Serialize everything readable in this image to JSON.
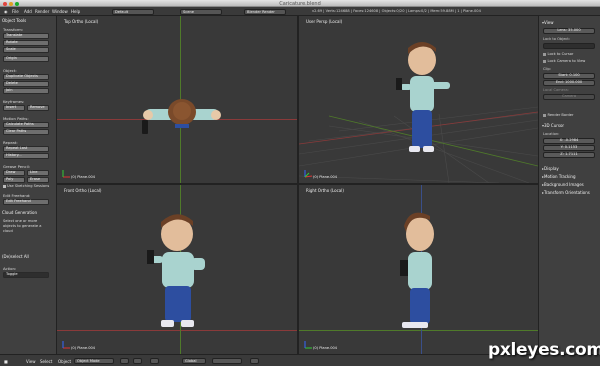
{
  "window": {
    "title": "Caricature.blend"
  },
  "menu": {
    "file": "File",
    "add": "Add",
    "render": "Render",
    "window": "Window",
    "help": "Help"
  },
  "header": {
    "layout": "Default",
    "scene": "Scene",
    "engine": "Blender Render",
    "stats": "v2.69 | Verts:124688 | Faces:124608 | Objects:0/20 | Lamps:0/2 | Mem:59.88M | 1 | Plane.004"
  },
  "toolshelf": {
    "title": "Object Tools",
    "transform_title": "Transform:",
    "translate": "Translate",
    "rotate": "Rotate",
    "scale": "Scale",
    "origin": "Origin",
    "object_title": "Object:",
    "duplicate_objects": "Duplicate Objects",
    "delete": "Delete",
    "join": "Join",
    "keyframes_title": "Keyframes:",
    "insert": "Insert",
    "remove": "Remove",
    "motion_paths_title": "Motion Paths:",
    "calculate_paths": "Calculate Paths",
    "clear_paths": "Clear Paths",
    "repeat_title": "Repeat:",
    "repeat_last": "Repeat Last",
    "history": "History...",
    "grease_pencil_title": "Grease Pencil:",
    "draw": "Draw",
    "line": "Line",
    "poly": "Poly",
    "erase": "Erase",
    "use_sketching": "Use Sketching Sessions",
    "edit_title": "Edit Freehand:",
    "edit_freehand": "Edit Freehand",
    "cloud_title": "Cloud Generation",
    "cloud_hint": "Select one or more objects to generate a cloud",
    "last_op_title": "(De)select All",
    "action_label": "Action:",
    "action_value": "Toggle"
  },
  "viewports": {
    "top_left": {
      "label": "Top Ortho (Local)",
      "object": "(0) Plane.004"
    },
    "top_right": {
      "label": "User Persp (Local)",
      "object": "(0) Plane.004"
    },
    "bottom_left": {
      "label": "Front Ortho (Local)",
      "object": "(0) Plane.004"
    },
    "bottom_right": {
      "label": "Right Ortho (Local)",
      "object": "(0) Plane.004"
    }
  },
  "properties": {
    "view_title": "View",
    "lens": "Lens: 35.000",
    "lock_to_object": "Lock to Object:",
    "lock_to_cursor": "Lock to Cursor",
    "lock_camera": "Lock Camera to View",
    "clip_title": "Clip:",
    "clip_start": "Start: 0.100",
    "clip_end": "End: 1000.000",
    "local_camera": "Local Camera:",
    "camera_field": "Camera",
    "render_border": "Render Border",
    "cursor_title": "3D Cursor",
    "location_title": "Location:",
    "cursor_x": "X: -0.2984",
    "cursor_y": "Y: 0.1153",
    "cursor_z": "Z: 1.7111",
    "display_title": "Display",
    "motion_tracking": "Motion Tracking",
    "background_images": "Background Images",
    "transform_orientations": "Transform Orientations"
  },
  "bottombar": {
    "view": "View",
    "select": "Select",
    "object": "Object",
    "mode": "Object Mode",
    "pivot": "Global"
  },
  "watermark": "pxleyes.com"
}
